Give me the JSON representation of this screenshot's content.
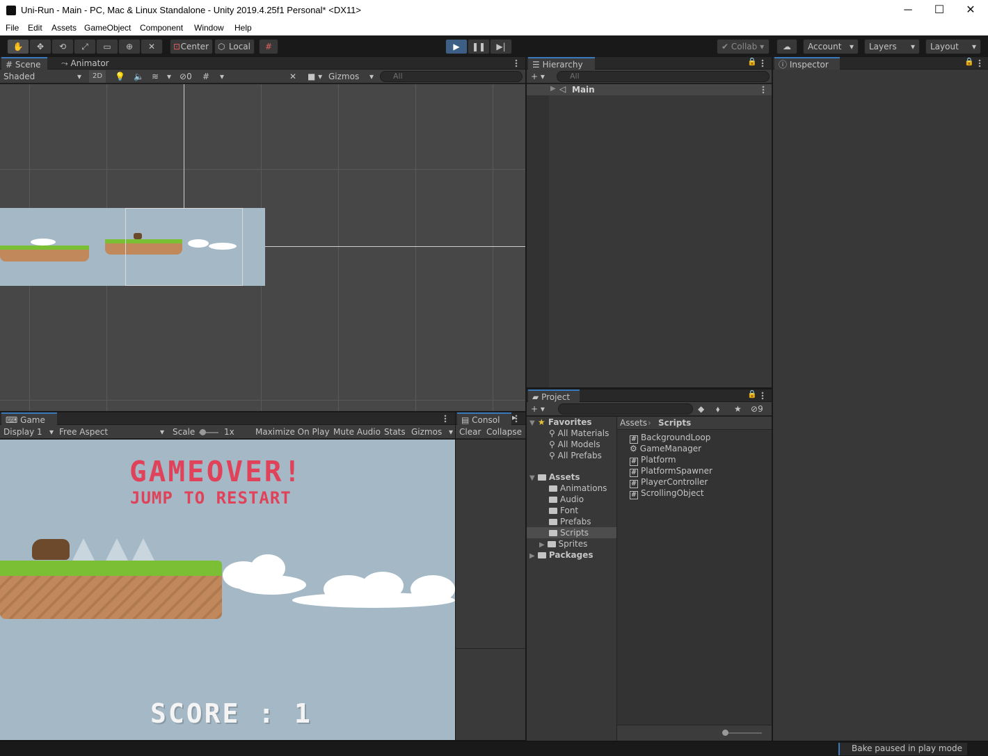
{
  "window": {
    "title": "Uni-Run - Main - PC, Mac & Linux Standalone - Unity 2019.4.25f1 Personal* <DX11>",
    "minimize": "─",
    "maximize": "☐",
    "close": "✕"
  },
  "menu": [
    "File",
    "Edit",
    "Assets",
    "GameObject",
    "Component",
    "Window",
    "Help"
  ],
  "toolbar": {
    "pivot": "Center",
    "space": "Local",
    "collab": "Collab",
    "account": "Account",
    "layers": "Layers",
    "layout": "Layout",
    "icons": [
      "hand-tool-icon",
      "move-tool-icon",
      "rotate-tool-icon",
      "scale-tool-icon",
      "rect-tool-icon",
      "transform-tool-icon",
      "custom-tool-icon"
    ]
  },
  "scene": {
    "tabs": [
      "Scene",
      "Animator"
    ],
    "shading": "Shaded",
    "mode2d": "2D",
    "hidden_count": "0",
    "gizmos": "Gizmos",
    "search_placeholder": "All"
  },
  "hierarchy": {
    "tab": "Hierarchy",
    "search_placeholder": "All",
    "root": "Main"
  },
  "inspector": {
    "tab": "Inspector"
  },
  "game": {
    "tab": "Game",
    "display": "Display 1",
    "aspect": "Free Aspect",
    "scale_label": "Scale",
    "scale_value": "1x",
    "maximize": "Maximize On Play",
    "mute": "Mute Audio",
    "stats": "Stats",
    "gizmos": "Gizmos",
    "gameover": "GAMEOVER!",
    "restart": "JUMP TO RESTART",
    "score": "SCORE : 1"
  },
  "console": {
    "tab": "Consol",
    "clear": "Clear",
    "collapse": "Collapse"
  },
  "project": {
    "tab": "Project",
    "hidden_count": "9",
    "favorites_label": "Favorites",
    "favorites": [
      "All Materials",
      "All Models",
      "All Prefabs"
    ],
    "assets_label": "Assets",
    "asset_folders": [
      "Animations",
      "Audio",
      "Font",
      "Prefabs",
      "Scripts",
      "Sprites"
    ],
    "packages_label": "Packages",
    "breadcrumb": [
      "Assets",
      "Scripts"
    ],
    "files": [
      "BackgroundLoop",
      "GameManager",
      "Platform",
      "PlatformSpawner",
      "PlayerController",
      "ScrollingObject"
    ]
  },
  "status": {
    "message": "Bake paused in play mode"
  }
}
